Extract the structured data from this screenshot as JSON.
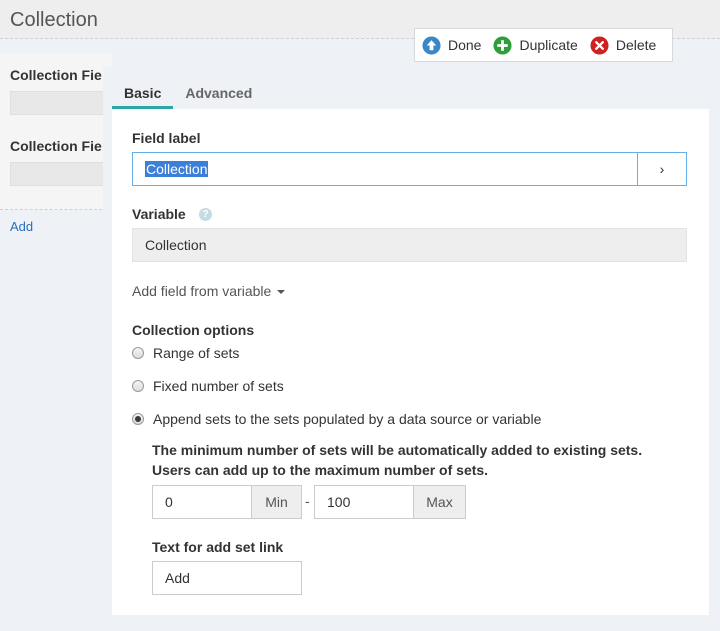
{
  "page": {
    "title": "Collection"
  },
  "background_panel": {
    "labels": [
      "Collection Fie",
      "Collection Fie"
    ],
    "add_link": "Add"
  },
  "actions": {
    "done": "Done",
    "duplicate": "Duplicate",
    "delete": "Delete"
  },
  "tabs": [
    {
      "label": "Basic",
      "active": true
    },
    {
      "label": "Advanced",
      "active": false
    }
  ],
  "field_label": {
    "label": "Field label",
    "value": "Collection",
    "button": "›"
  },
  "variable": {
    "label": "Variable",
    "help": "?",
    "value": "Collection"
  },
  "add_field_from_variable": "Add field from variable",
  "collection_options": {
    "label": "Collection options",
    "options": [
      {
        "label": "Range of sets",
        "selected": false
      },
      {
        "label": "Fixed number of sets",
        "selected": false
      },
      {
        "label": "Append sets to the sets populated by a data source or variable",
        "selected": true
      }
    ],
    "description_line1": "The minimum number of sets will be automatically added to existing sets.",
    "description_line2": "Users can add up to the maximum number of sets.",
    "min_value": "0",
    "min_addon": "Min",
    "separator": "-",
    "max_value": "100",
    "max_addon": "Max"
  },
  "add_set_link": {
    "label": "Text for add set link",
    "value": "Add"
  },
  "colors": {
    "accent": "#2aa8a8",
    "link": "#2a6ebb",
    "done_icon": "#3a87c8",
    "duplicate_icon": "#2e9e3a",
    "delete_icon": "#cc2222"
  }
}
